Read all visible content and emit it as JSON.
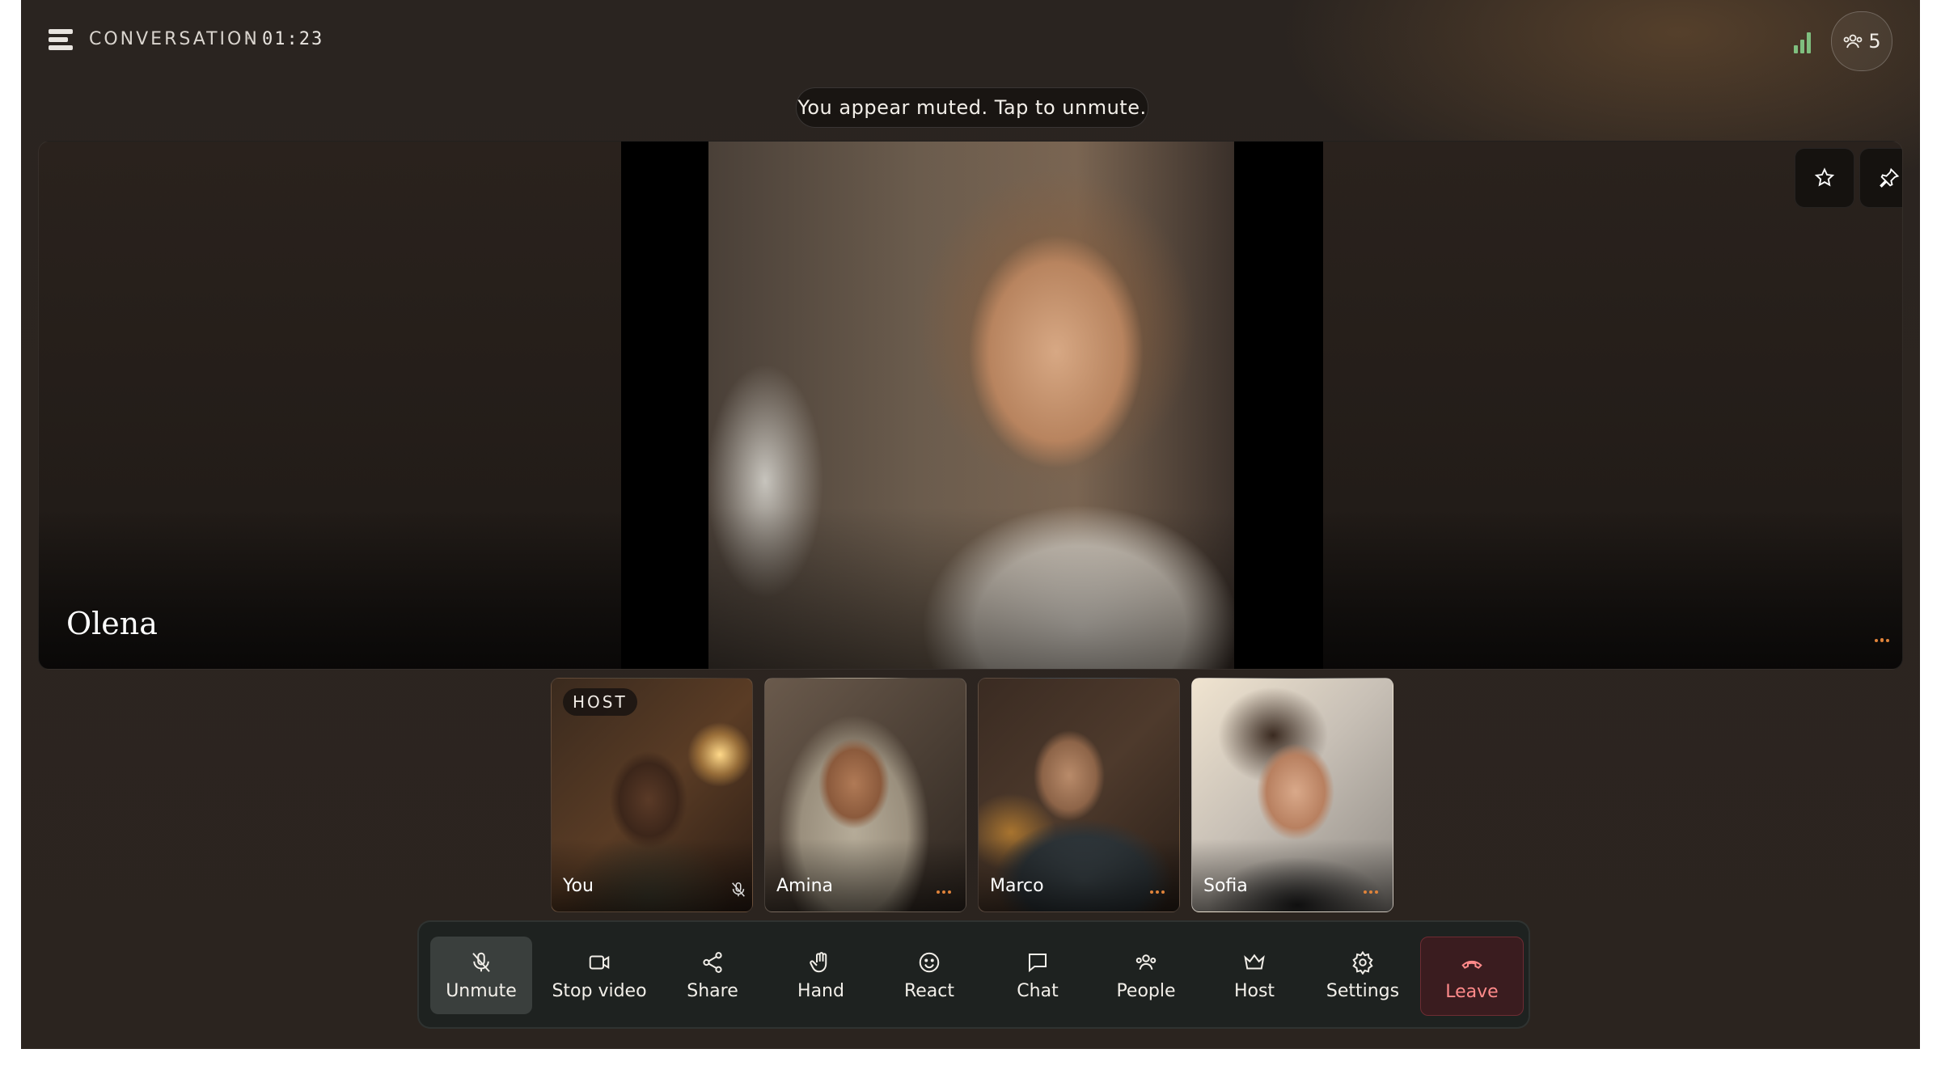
{
  "header": {
    "title": "CONVERSATION",
    "separator": "·",
    "elapsed": "01:23",
    "participant_count": "5"
  },
  "toast": {
    "text": "You appear muted. Tap to unmute."
  },
  "stage": {
    "speaker_name": "Olena",
    "buttons": [
      "star-icon",
      "pin-icon"
    ]
  },
  "participants": [
    {
      "name": "You",
      "badge": "HOST",
      "muted": true
    },
    {
      "name": "Amina",
      "speaking": true
    },
    {
      "name": "Marco",
      "speaking": true
    },
    {
      "name": "Sofia",
      "speaking": true
    }
  ],
  "controls": [
    {
      "label": "Unmute",
      "icon": "mic-off-icon",
      "active": true
    },
    {
      "label": "Stop video",
      "icon": "video-icon"
    },
    {
      "label": "Share",
      "icon": "share-icon"
    },
    {
      "label": "Hand",
      "icon": "hand-icon"
    },
    {
      "label": "React",
      "icon": "smile-icon"
    },
    {
      "label": "Chat",
      "icon": "chat-icon"
    },
    {
      "label": "People",
      "icon": "people-icon"
    },
    {
      "label": "Host",
      "icon": "crown-icon"
    },
    {
      "label": "Settings",
      "icon": "gear-icon"
    },
    {
      "label": "Leave",
      "icon": "phone-hangup-icon",
      "danger": true
    }
  ],
  "colors": {
    "accent_speaking": "#e0833a",
    "signal": "#7fbf7f",
    "leave": "#ff8a8a"
  }
}
